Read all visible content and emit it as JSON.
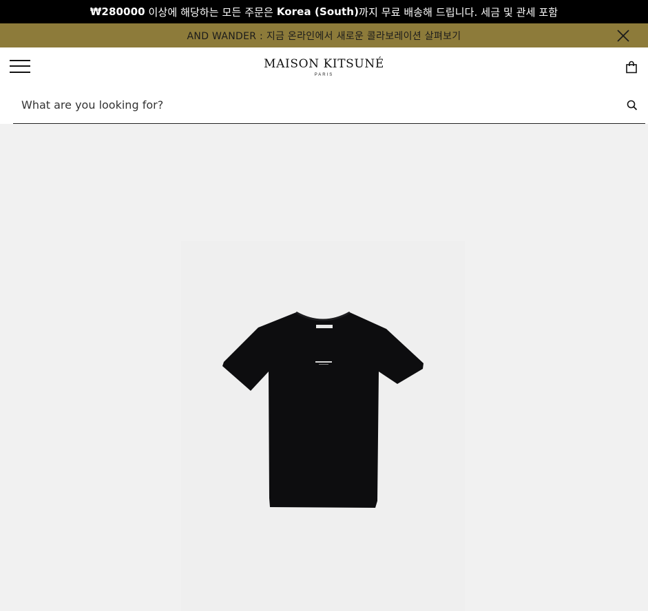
{
  "shipping_banner": {
    "amount": "₩280000",
    "text_before": " 이상에 해당하는 모든 주문은 ",
    "country": "Korea (South)",
    "text_after": "까지 무료 배송해 드립니다. 세금 및 관세 포함"
  },
  "promo_banner": {
    "text": "AND WANDER : 지금 온라인에서 새로운 콜라보레이션 살펴보기",
    "close_icon": "close-icon"
  },
  "header": {
    "logo": "MAISON KITSUNÉ",
    "logo_sub": "PARIS",
    "menu_icon": "hamburger-menu-icon",
    "cart_icon": "shopping-bag-icon"
  },
  "search": {
    "placeholder": "What are you looking for?",
    "icon": "search-icon"
  },
  "product": {
    "image_alt": "black t-shirt",
    "colors": {
      "shirt": "#0d0d0f",
      "background": "#f1f1f1"
    }
  },
  "colors": {
    "shipping_bar_bg": "#000000",
    "promo_bar_bg": "#8d7b3a",
    "page_bg": "#f1f1f1"
  }
}
